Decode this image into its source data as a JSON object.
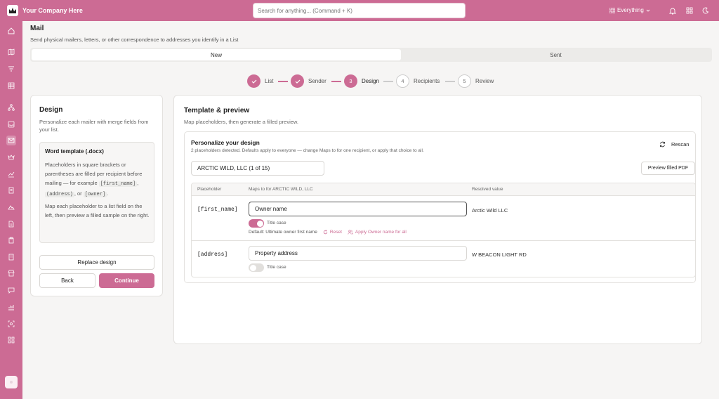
{
  "topbar": {
    "company": "Your Company Here",
    "search_placeholder": "Search for anything... (Command + K)",
    "scope_label": "Everything"
  },
  "page": {
    "title": "Mail",
    "subtitle": "Send physical mailers, letters, or other correspondence to addresses you identify in a List"
  },
  "tabs": [
    {
      "label": "New",
      "active": true
    },
    {
      "label": "Sent",
      "active": false
    }
  ],
  "stepper": [
    {
      "number": "1",
      "label": "List",
      "state": "done"
    },
    {
      "number": "2",
      "label": "Sender",
      "state": "done"
    },
    {
      "number": "3",
      "label": "Design",
      "state": "current"
    },
    {
      "number": "4",
      "label": "Recipients",
      "state": "todo"
    },
    {
      "number": "5",
      "label": "Review",
      "state": "todo"
    }
  ],
  "left_panel": {
    "title": "Design",
    "description": "Personalize each mailer with merge fields from your list.",
    "info_title": "Word template (.docx)",
    "info_text_1": "Placeholders in square brackets or parentheses are filled per recipient before mailing — for example",
    "code_1": "[first_name]",
    "code_2": "(address)",
    "or_text": ", or",
    "code_3": "[owner]",
    "info_text_2": "Map each placeholder to a list field on the left, then preview a filled sample on the right.",
    "replace_button": "Replace design",
    "back_button": "Back",
    "continue_button": "Continue"
  },
  "right_panel": {
    "title": "Template & preview",
    "subtitle": "Map placeholders, then generate a filled preview.",
    "personalize_title": "Personalize your design",
    "personalize_sub": "2 placeholders detected. Defaults apply to everyone — change Maps to for one recipient, or apply that choice to all.",
    "rescan_label": "Rescan",
    "recipient_select": "ARCTIC WILD, LLC (1 of 15)",
    "preview_button": "Preview filled PDF",
    "table_headers": {
      "placeholder": "Placeholder",
      "maps_to": "Maps to for ARCTIC WILD, LLC",
      "resolved": "Resolved value"
    },
    "rows": [
      {
        "placeholder": "[first_name]",
        "maps_to": "Owner name",
        "title_case_label": "Title case",
        "title_case_on": true,
        "default_text": "Default: Ultimate owner first name",
        "reset_label": "Reset",
        "apply_label": "Apply Owner name for all",
        "resolved": "Arctic Wild LLC"
      },
      {
        "placeholder": "[address]",
        "maps_to": "Property address",
        "title_case_label": "Title case",
        "title_case_on": false,
        "resolved": "W BEACON LIGHT RD"
      }
    ]
  },
  "colors": {
    "brand": "#cc6b94",
    "background": "#f6f5f4"
  },
  "icons": {
    "sidebar": [
      "home-icon",
      "map-icon",
      "filter-icon",
      "table-icon",
      "network-icon",
      "inbox-icon",
      "mail-icon",
      "crown-icon",
      "chart-icon",
      "document-icon",
      "landscape-icon",
      "file-icon",
      "clipboard-icon",
      "building-icon",
      "store-icon",
      "chat-icon",
      "graph-icon",
      "scan-icon",
      "grid-icon"
    ]
  }
}
